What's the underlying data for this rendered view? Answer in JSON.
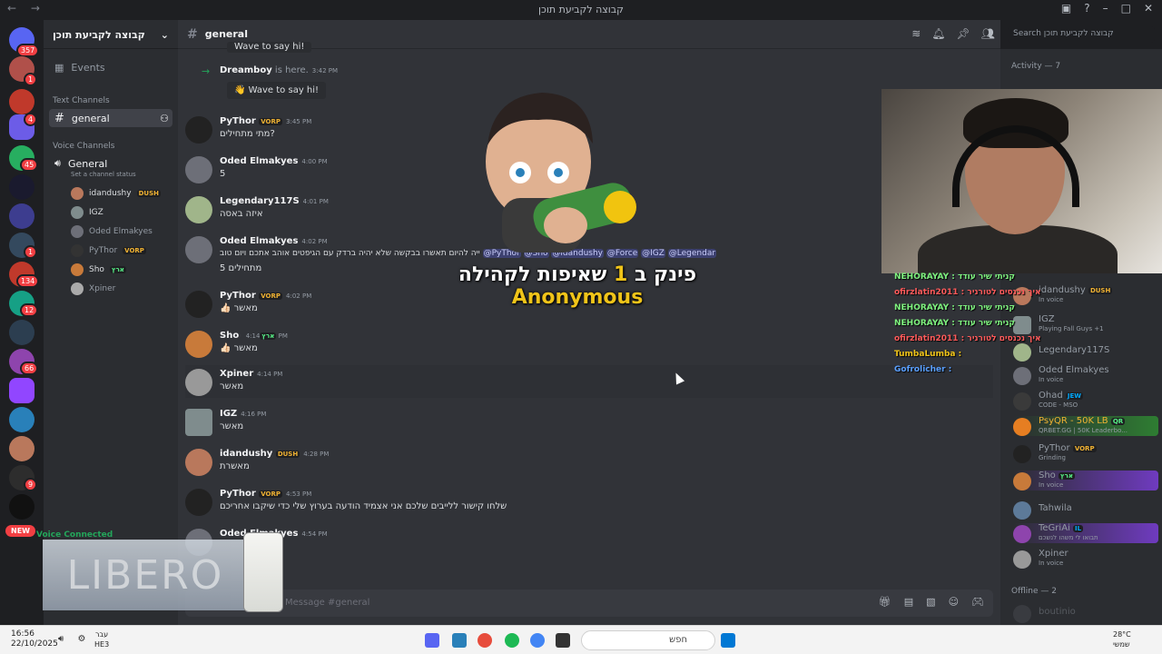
{
  "window": {
    "title": "קבוצה לקביעת תוכן"
  },
  "server": {
    "name": "קבוצה לקביעת תוכן"
  },
  "server_badges": [
    "357",
    "1",
    "4",
    "45",
    "1",
    "134",
    "12",
    "66",
    "9"
  ],
  "new_label": "NEW",
  "channels": {
    "events": "Events",
    "text_category": "Text Channels",
    "text_channel": "general",
    "voice_category": "Voice Channels",
    "voice_channel": "General",
    "voice_status": "Set a channel status",
    "voice_users": [
      {
        "name": "idandushy",
        "tag": "DUSH"
      },
      {
        "name": "IGZ",
        "tag": ""
      },
      {
        "name": "Oded Elmakyes",
        "tag": ""
      },
      {
        "name": "PyThor",
        "tag": "VORP"
      },
      {
        "name": "Sho",
        "tag": "ארץ"
      },
      {
        "name": "Xpiner",
        "tag": ""
      }
    ]
  },
  "voice_connected": "Voice Connected",
  "header": {
    "channel": "general",
    "search_placeholder": "Search קבוצה לקביעת תוכן"
  },
  "messages": [
    {
      "sys": true,
      "author": "Dreamboy",
      "suffix": " is here.",
      "time": "3:42 PM",
      "button": "Wave to say hi!"
    },
    {
      "author": "PyThor",
      "tag": "VORP",
      "time": "3:45 PM",
      "text": "מתי מתחילים?"
    },
    {
      "author": "Oded Elmakyes",
      "time": "4:00 PM",
      "text": "5"
    },
    {
      "author": "Legendary117S",
      "time": "4:01 PM",
      "text": "איזה באסה"
    },
    {
      "author": "Oded Elmakyes",
      "time": "4:02 PM",
      "text": "ייה להיום תאשרו בבקשה שלא יהיה ברדק עם הגיפטים אוהב אתכם ויום טוב",
      "mentions": [
        "@PyThor",
        "@Sho",
        "@idandushy",
        "@Force",
        "@IGZ",
        "@Legendar"
      ],
      "text2": "5 מתחילים"
    },
    {
      "author": "PyThor",
      "tag": "VORP",
      "time": "4:02 PM",
      "text": "👍🏻 מאשר"
    },
    {
      "author": "Sho",
      "tag": "ארץ",
      "time": "4:14 PM",
      "text": "👍🏻 מאשר"
    },
    {
      "author": "Xpiner",
      "time": "4:14 PM",
      "text": "מאשר"
    },
    {
      "author": "IGZ",
      "time": "4:16 PM",
      "text": "מאשר"
    },
    {
      "author": "idandushy",
      "tag": "DUSH",
      "time": "4:28 PM",
      "text": "מאשרת"
    },
    {
      "author": "PyThor",
      "tag": "VORP",
      "time": "4:53 PM",
      "text": "שלחו קישור ללייבים שלכם אני אצמיד הודעה בערוץ שלי כדי שיקבו אחריכם"
    },
    {
      "author": "Oded Elmakyes",
      "time": "4:54 PM",
      "text": ""
    }
  ],
  "wave_top": "Wave to say hi!",
  "composer_placeholder": "Message #general",
  "overlay": {
    "alert_prefix": "פינק ב",
    "alert_num": "1",
    "alert_suffix": "שאיפות לקהילה",
    "alert_name": "Anonymous",
    "chatlog": [
      "NEHORAYAY : קניתי שיר עודד",
      "ofirzlatin2011 : איך נכנסים לטורניר",
      "NEHORAYAY : קניתי שיר עודד",
      "NEHORAYAY : קניתי שיר עודד",
      "ofirzlatin2011 : איך נכנסים לטורניר",
      "TumbaLumba :",
      "Gofrolicher :"
    ],
    "libero": "LIBERO"
  },
  "members": {
    "activity": "Activity — 7",
    "list": [
      {
        "name": "idandushy",
        "tag": "DUSH",
        "status": "In voice"
      },
      {
        "name": "IGZ",
        "status": "Playing Fall Guys +1"
      },
      {
        "name": "Legendary117S",
        "status": ""
      },
      {
        "name": "Oded Elmakyes",
        "status": "In voice"
      },
      {
        "name": "Ohad",
        "tag": "JEW",
        "status": "CODE - MSO"
      },
      {
        "name": "PsyQR - 50K LB",
        "tag": "QR",
        "status": "QRBET.GG | 50K Leaderbo..."
      },
      {
        "name": "PyThor",
        "tag": "VORP",
        "status": "Grinding"
      },
      {
        "name": "Sho",
        "tag": "ארץ",
        "status": "In voice"
      },
      {
        "name": "Tahwila",
        "status": ""
      },
      {
        "name": "TeGriAi",
        "tag": "IL",
        "status": "תבואו לי משהו לנשכם"
      },
      {
        "name": "Xpiner",
        "status": "In voice"
      }
    ],
    "offline": "Offline — 2",
    "offline_first": "boutinio"
  },
  "taskbar": {
    "time": "16:56",
    "date": "22/10/2025",
    "lang1": "עבר",
    "lang2": "HE3",
    "search": "חפש",
    "temp": "28°C",
    "weather": "שמשי"
  }
}
